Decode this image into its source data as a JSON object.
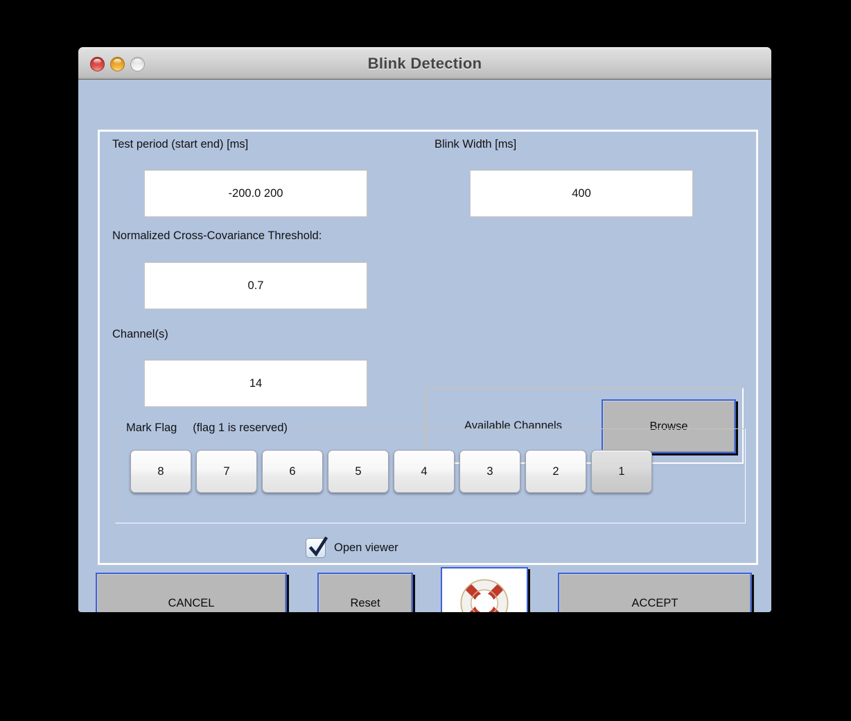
{
  "window": {
    "title": "Blink Detection",
    "traffic_lights": [
      "close-button",
      "minimize-button",
      "maximize-button"
    ]
  },
  "fields": {
    "test_period": {
      "label": "Test period (start end)  [ms]",
      "value": "-200.0  200"
    },
    "blink_width": {
      "label": "Blink Width [ms]",
      "value": "400"
    },
    "threshold": {
      "label": "Normalized Cross-Covariance Threshold:",
      "value": "0.7"
    },
    "channels": {
      "label": "Channel(s)",
      "value": "14"
    }
  },
  "available_channels": {
    "label": "Available Channels",
    "browse_label": "Browse"
  },
  "mark_flag": {
    "legend": "Mark Flag     (flag 1 is reserved)",
    "buttons": [
      {
        "label": "8",
        "reserved": false
      },
      {
        "label": "7",
        "reserved": false
      },
      {
        "label": "6",
        "reserved": false
      },
      {
        "label": "5",
        "reserved": false
      },
      {
        "label": "4",
        "reserved": false
      },
      {
        "label": "3",
        "reserved": false
      },
      {
        "label": "2",
        "reserved": false
      },
      {
        "label": "1",
        "reserved": true
      }
    ]
  },
  "open_viewer": {
    "label": "Open viewer",
    "checked": true
  },
  "actions": {
    "cancel_label": "CANCEL",
    "reset_label": "Reset",
    "accept_label": "ACCEPT",
    "help_icon": "lifebuoy-icon"
  },
  "colors": {
    "window_background": "#b2c3de",
    "panel_border": "#fbfbfb",
    "button_face": "#b8b8b8",
    "focus_border": "#3a62d8",
    "field_background": "#ffffff",
    "title_text": "#454545",
    "lifebuoy_red": "#c0392b"
  }
}
